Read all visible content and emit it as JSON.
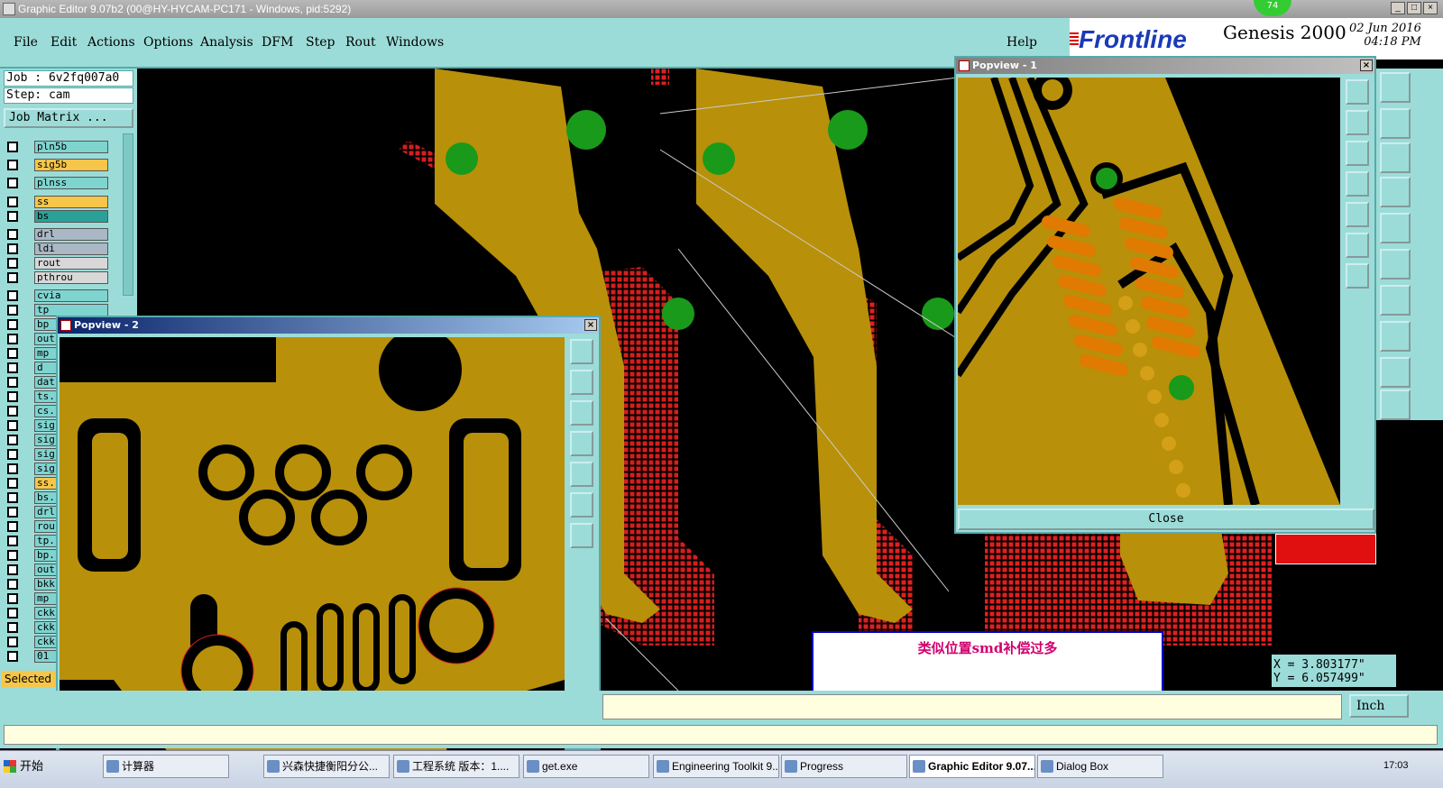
{
  "window": {
    "title": "Graphic Editor 9.07b2 (00@HY-HYCAM-PC171 - Windows, pid:5292)"
  },
  "badge": "74",
  "menu": [
    "File",
    "Edit",
    "Actions",
    "Options",
    "Analysis",
    "DFM",
    "Step",
    "Rout",
    "Windows"
  ],
  "help": "Help",
  "brand": {
    "logo": "Frontline",
    "product": "Genesis 2000",
    "date": "02 Jun 2016",
    "time": "04:18 PM"
  },
  "job": {
    "job_label": "Job : 6v2fq007a0",
    "step_label": "Step: cam",
    "matrix_button": "Job Matrix ..."
  },
  "layers": [
    {
      "name": "pln5b",
      "color": "#7fd4d0"
    },
    {
      "name": "sig5b",
      "color": "#f5c64a"
    },
    {
      "name": "plnss",
      "color": "#7fd4d0"
    },
    {
      "name": "ss",
      "color": "#f5c64a"
    },
    {
      "name": "bs",
      "color": "#2aa198"
    },
    {
      "name": "drl",
      "color": "#a9b8c4"
    },
    {
      "name": "ldi",
      "color": "#a9b8c4"
    },
    {
      "name": "rout",
      "color": "#d8d8d8"
    },
    {
      "name": "pthrou",
      "color": "#d8d8d8"
    },
    {
      "name": "cvia",
      "color": "#7fd4d0"
    },
    {
      "name": "tp",
      "color": "#7fd4d0"
    },
    {
      "name": "bp",
      "color": "#7fd4d0"
    },
    {
      "name": "out",
      "color": "#7fd4d0"
    },
    {
      "name": "mp",
      "color": "#7fd4d0"
    },
    {
      "name": "d",
      "color": "#7fd4d0"
    },
    {
      "name": "dat",
      "color": "#7fd4d0"
    },
    {
      "name": "ts.",
      "color": "#7fd4d0"
    },
    {
      "name": "cs.",
      "color": "#7fd4d0"
    },
    {
      "name": "sig",
      "color": "#7fd4d0"
    },
    {
      "name": "sig",
      "color": "#7fd4d0"
    },
    {
      "name": "sig",
      "color": "#7fd4d0"
    },
    {
      "name": "sig",
      "color": "#7fd4d0"
    },
    {
      "name": "ss.",
      "color": "#f5c64a"
    },
    {
      "name": "bs.",
      "color": "#7fd4d0"
    },
    {
      "name": "drl",
      "color": "#7fd4d0"
    },
    {
      "name": "rou",
      "color": "#7fd4d0"
    },
    {
      "name": "tp.",
      "color": "#7fd4d0"
    },
    {
      "name": "bp.",
      "color": "#7fd4d0"
    },
    {
      "name": "out",
      "color": "#7fd4d0"
    },
    {
      "name": "bkk",
      "color": "#7fd4d0"
    },
    {
      "name": "mp",
      "color": "#7fd4d0"
    },
    {
      "name": "ckk",
      "color": "#7fd4d0"
    },
    {
      "name": "ckk",
      "color": "#7fd4d0"
    },
    {
      "name": "ckk",
      "color": "#7fd4d0"
    },
    {
      "name": "01",
      "color": "#7fd4d0"
    }
  ],
  "selected_label": "Selected",
  "popview1": {
    "title": "Popview - 1",
    "close": "Close"
  },
  "popview2": {
    "title": "Popview - 2"
  },
  "annotation": "类似位置smd补偿过多",
  "coords": {
    "x": "X = 3.803177\"",
    "y": "Y = 6.057499\""
  },
  "units": "Inch",
  "taskbar": {
    "start": "开始",
    "items": [
      "计算器",
      "兴森快捷衡阳分公...",
      "工程系统  版本：1....",
      "get.exe",
      "Engineering Toolkit 9....",
      "Progress",
      "Graphic Editor 9.07...",
      "Dialog Box"
    ],
    "clock": "17:03"
  },
  "colors": {
    "board": "#b8900a",
    "copper_line": "#d4a017",
    "marker": "#e02020",
    "pad_green": "#1a9a1a",
    "panel": "#9cdcd8"
  }
}
